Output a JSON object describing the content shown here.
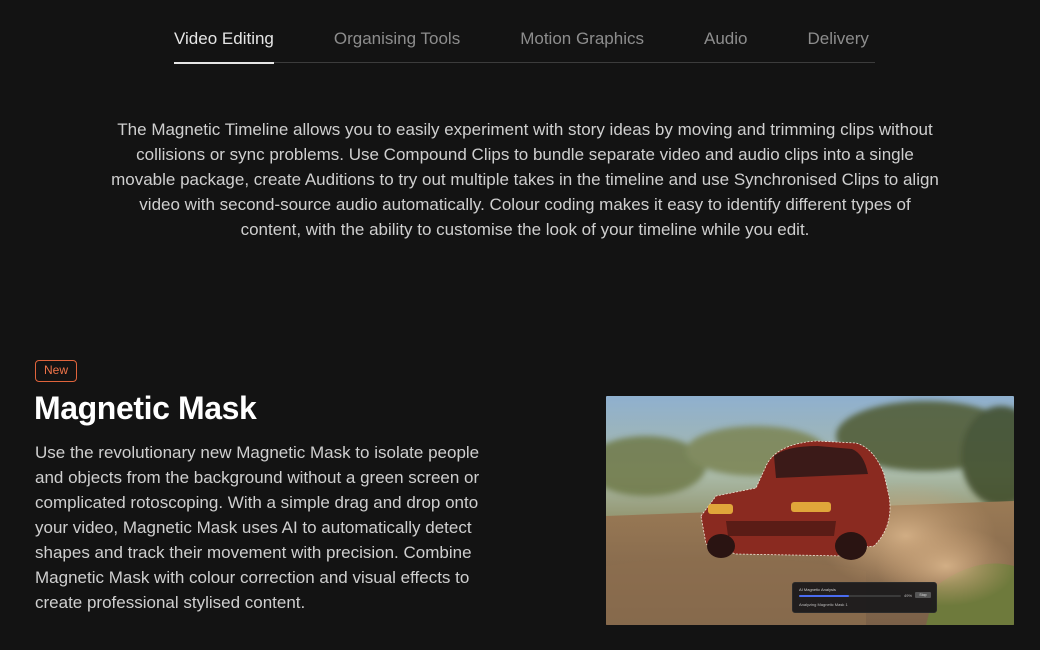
{
  "tabs": [
    {
      "label": "Video Editing",
      "active": true
    },
    {
      "label": "Organising Tools",
      "active": false
    },
    {
      "label": "Motion Graphics",
      "active": false
    },
    {
      "label": "Audio",
      "active": false
    },
    {
      "label": "Delivery",
      "active": false
    }
  ],
  "intro": "The Magnetic Timeline allows you to easily experiment with story ideas by moving and trimming clips without collisions or sync problems. Use Compound Clips to bundle separate video and audio clips into a single movable package, create Auditions to try out multiple takes in the timeline and use Synchronised Clips to align video with second-source audio automatically. Colour coding makes it easy to identify different types of content, with the ability to customise the look of your timeline while you edit.",
  "feature": {
    "badge": "New",
    "title": "Magnetic Mask",
    "description": "Use the revolutionary new Magnetic Mask to isolate people and objects from the background without a green screen or complicated rotoscoping. With a simple drag and drop onto your video, Magnetic Mask uses AI to automatically detect shapes and track their movement with precision. Combine Magnetic Mask with colour correction and visual effects to create professional stylised content."
  },
  "analysis_panel": {
    "title": "AI Magnetic Analysis",
    "progress_percent": 49,
    "progress_label": "49%",
    "stop_label": "Stop",
    "status": "Analyzing Magnetic Mask 1"
  },
  "colors": {
    "accent": "#f07449",
    "background": "#131313",
    "progress": "#4a6cf0"
  }
}
